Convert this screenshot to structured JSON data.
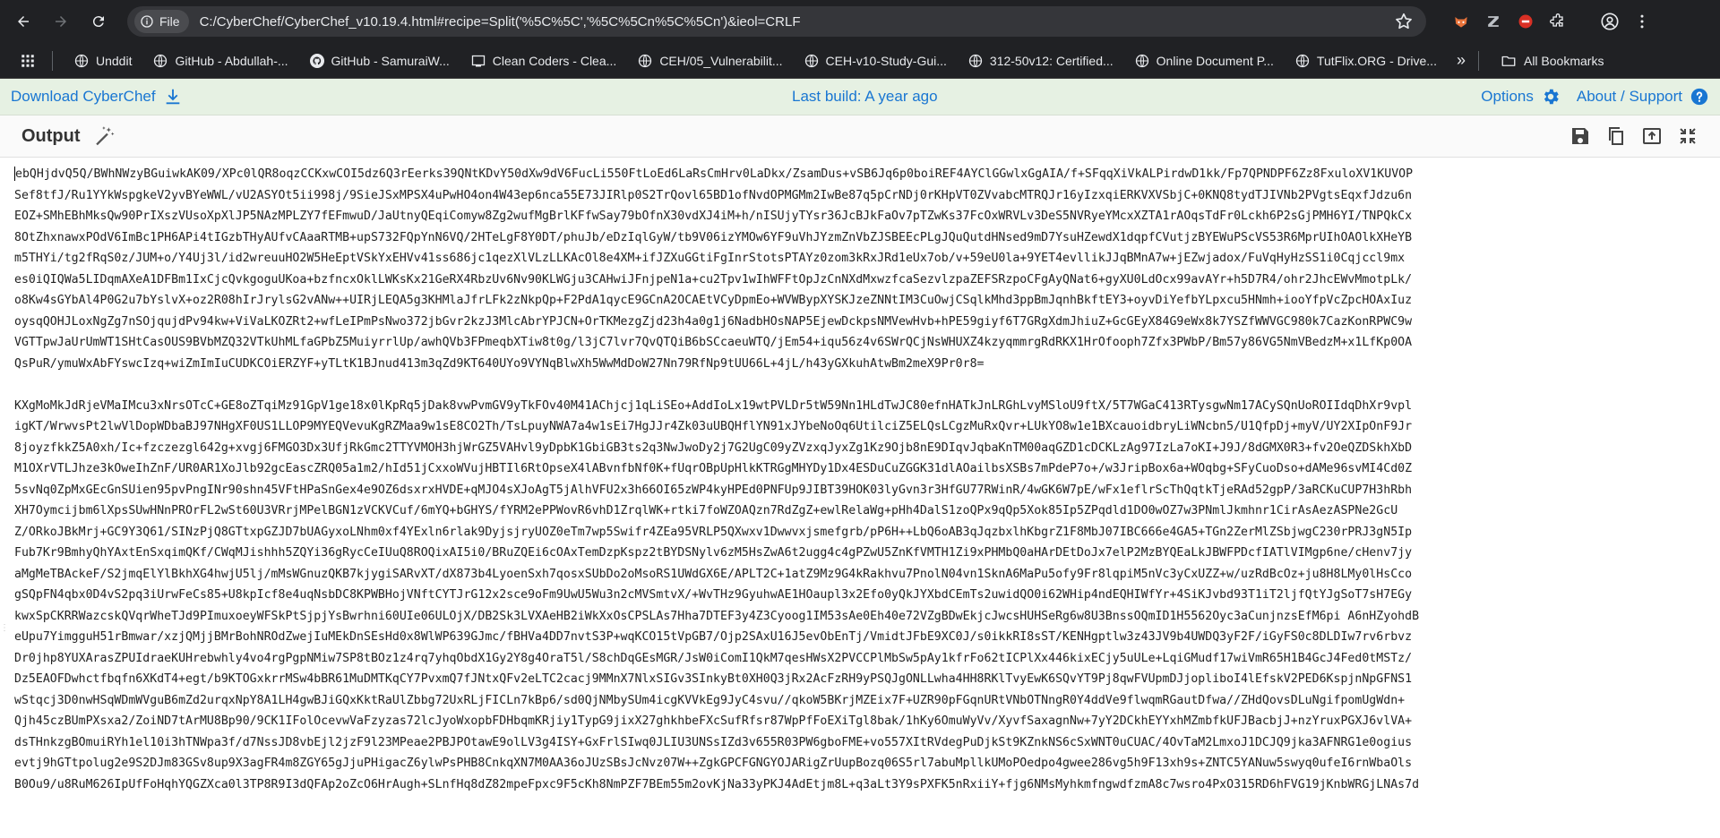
{
  "browser": {
    "url": "C:/CyberChef/CyberChef_v10.19.4.html#recipe=Split('%5C%5C','%5C%5Cn%5C%5Cn')&ieol=CRLF",
    "file_chip": "File",
    "bookmarks": [
      {
        "label": "Unddit",
        "icon": "globe-icon"
      },
      {
        "label": "GitHub - Abdullah-...",
        "icon": "globe-icon"
      },
      {
        "label": "GitHub - SamuraiW...",
        "icon": "github-icon"
      },
      {
        "label": "Clean Coders - Clea...",
        "icon": "cleancoders-icon"
      },
      {
        "label": "CEH/05_Vulnerabilit...",
        "icon": "globe-icon"
      },
      {
        "label": "CEH-v10-Study-Gui...",
        "icon": "globe-icon"
      },
      {
        "label": "312-50v12: Certified...",
        "icon": "globe-icon"
      },
      {
        "label": "Online Document P...",
        "icon": "globe-icon"
      },
      {
        "label": "TutFlix.ORG - Drive...",
        "icon": "globe-icon"
      }
    ],
    "bookmarks_more": "»",
    "all_bookmarks": "All Bookmarks"
  },
  "banner": {
    "download": "Download CyberChef",
    "last_build": "Last build: A year ago",
    "options": "Options",
    "about": "About / Support"
  },
  "output": {
    "title": "Output",
    "block1": [
      "ebQHjdvQ5Q/BWhNWzyBGuiwkAK09/XPc0lQR8oqzCCKxwCOI5dz6Q3rEerks39QNtKDvY50dXw9dV6FucLi550FtLoEd6LaRsCmHrv0LaDkx/ZsamDus+vSB6Jq6p0boiREF4AYClGGwlxGgAIA/f+SFqqXiVkALPirdwD1kk/Fp7QPNDPF6Zz8FxuloXV1KUVOP",
      "Sef8tfJ/Ru1YYkWspgkeV2yvBYeWWL/vU2ASYOt5ii998j/9SieJSxMPSX4uPwHO4on4W43ep6nca55E73JIRlp0S2TrQovl65BD1ofNvdOPMGMm2IwBe87q5pCrNDj0rKHpVT0ZVvabcMTRQJr16yIzxqiERKVXVSbjC+0KNQ8tydTJIVNb2PVgtsEqxfJdzu6n",
      "EOZ+SMhEBhMksQw90PrIXszVUsoXpXlJP5NAzMPLZY7fEFmwuD/JaUtnyQEqiComyw8Zg2wufMgBrlKFfwSay79bOfnX30vdXJ4iM+h/nISUjyTYsr36JcBJkFaOv7pTZwKs37FcOxWRVLv3DeS5NVRyeYMcxXZTA1rAOqsTdFr0Lckh6P2sGjPMH6YI/TNPQkCx",
      "8OtZhxnawxPOdV6ImBc1PH6APi4tIGzbTHyAUfvCAaaRTMB+upS732FQpYnN6VQ/2HTeLgF8Y0DT/phuJb/eDzIqlGyW/tb9V06izYMOw6YF9uVhJYzmZnVbZJSBEEcPLgJQuQutdHNsed9mD7YsuHZewdX1dqpfCVutjzBYEWuPScVS53R6MprUIhOAOlkXHeYB",
      "m5THYi/tg2fRqS0z/JUM+o/Y4Uj3l/id2wreuuHO2W5HeEptVSkYxEHVv41ss686jc1qezXlVLzLLKAcOl8e4XM+ifJZXuGGtiFgInrStotsPTAYz0zom3kRxJRd1eUx7ob/v+59eU0la+9YET4evllikJJqBMnA7w+jEZwjadox/FuVqHyHzSS1i0Cqjccl9mx",
      "es0iQIQWa5LIDqmAXeA1DFBm1IxCjcQvkgoguUKoa+bzfncxOklLWKsKx21GeRX4RbzUv6Nv90KLWGju3CAHwiJFnjpeN1a+cu2Tpv1wIhWFFtOpJzCnNXdMxwzfcaSezvlzpaZEFSRzpoCFgAyQNat6+gyXU0LdOcx99avAYr+h5D7R4/ohr2JhcEWvMmotpLk/",
      "o8Kw4sGYbAl4P0G2u7bYslvX+oz2R08hIrJrylsG2vANw++UIRjLEQA5g3KHMlaJfrLFk2zNkpQp+F2PdA1qycE9GCnA2OCAEtVCyDpmEo+WVWBypXYSKJzeZNNtIM3CuOwjCSqlkMhd3ppBmJqnhBkftEY3+oyvDiYefbYLpxcu5HNmh+iooYfpVcZpcHOAxIuz",
      "oysqQOHJLoxNgZg7nSOjqujdPv94kw+ViVaLKOZRt2+wfLeIPmPsNwo372jbGvr2kzJ3MlcAbrYPJCN+OrTKMezgZjd23h4a0g1j6NadbHOsNAP5EjewDckpsNMVewHvb+hPE59giyf6T7GRgXdmJhiuZ+GcGEyX84G9eWx8k7YSZfWWVGC980k7CazKonRPWC9w",
      "VGTTpwJaUrUmWT1SHtCasOUS9BVbMZQ32VTkUhMLfaGPbZ5MuiyrrlUp/awhQVb3FPmeqbXTiw8t0g/l3jC7lvr7QvQTQiB6bSCcaeuWTQ/jEm54+iqu56z4v6SWrQCjNsWHUXZ4kzyqmmrgRdRKX1HrOfooph7Zfx3PWbP/Bm57y86VG5NmVBedzM+x1LfKp0OA",
      "QsPuR/ymuWxAbFYswcIzq+wiZmImIuCUDKCOiERZYF+yTLtK1BJnud413m3qZd9KT640UYo9VYNqBlwXh5WwMdDoW27Nn79RfNp9tUU66L+4jL/h43yGXkuhAtwBm2meX9Pr0r8="
    ],
    "block2": [
      "KXgMoMkJdRjeVMaIMcu3xNrsOTcC+GE8oZTqiMz91GpV1ge18x0lKpRq5jDak8vwPvmGV9yTkFOv40M41AChjcj1qLiSEo+AddIoLx19wtPVLDr5tW59Nn1HLdTwJC80efnHATkJnLRGhLvyMSloU9ftX/5T7WGaC413RTysgwNm17ACySQnUoROIIdqDhXr9vpl",
      "igKT/WrwvsPt2lwVlDopWDbaBJ97NHgXF0US1LLOP9MYEQVevuKgRZMaa9w1sE8CO2Th/TsLpuyNWA7a4w1sEi7HgJJr4Zk03uUBQHflYN91xJYbeNoOq6UtilciZ5ELQsLCgzMuRxQvr+LUkYO8w1e1BXcauoidbryLiWNcbn5/U1QfpDj+myV/UY2XIpOnF9Jr",
      "8joyzfkkZ5A0xh/Ic+fzczezgl642g+xvgj6FMGO3Dx3UfjRkGmc2TTYVMOH3hjWrGZ5VAHvl9yDpbK1GbiGB3ts2q3NwJwoDy2j7G2UgC09yZVzxqJyxZg1Kz9Ojb8nE9DIqvJqbaKnTM00aqGZD1cDCKLzAg97IzLa7oKI+J9J/8dGMX0R3+fv2OeQZDSkhXbD",
      "M1OXrVTLJhze3kOweIhZnF/UR0AR1XoJlb92gcEascZRQ05a1m2/hId51jCxxoWVujHBTIl6RtOpseX4lABvnfbNf0K+fUqrOBpUpHlkKTRGgMHYDy1Dx4ESDuCuZGGK31dlAOailbsXSBs7mPdeP7o+/w3JripBox6a+WOqbg+SFyCuoDso+dAMe96svMI4Cd0Z",
      "5svNq0ZpMxGEcGnSUien95pvPngINr90shn45VFtHPaSnGex4e9OZ6dsxrxHVDE+qMJO4sXJoAgT5jAlhVFU2x3h66OI65zWP4kyHPEd0PNFUp9JIBT39HOK03lyGvn3r3HfGU77RWinR/4wGK6W7pE/wFx1eflrScThQqtkTjeRAd52gpP/3aRCKuCUP7H3hRbh",
      "XH7Oymcijbm6lXpsSUwHNnPROrFL2wSt60U3VRrjMPelBGN1zVCKVCuf/6mYQ+bGHYS/fYRM2ePPWovR6vhD1ZrqlWK+rtki7foWZOAQzn7RdZgZ+ewlRelaWg+pHh4DalS1zoQPx9qQp5Xok85Ip5ZPqdld1DO0wOZ7w3PNmlJkmhnr1CirAsAezASPNe2GcU",
      "Z/ORkoJBkMrj+GC9Y3Q61/SINzPjQ8GTtxpGZJD7bUAGyxoLNhm0xf4YExln6rlak9DyjsjryUOZ0eTm7wp5Swifr4ZEa95VRLP5QXwxv1Dwwvxjsmefgrb/pP6H++LbQ6oAB3qJqzbxlhKbgrZ1F8MbJ07IBC666e4GA5+TGn2ZerMlZSbjwgC230rPRJ3gN5Ip",
      "Fub7Kr9BmhyQhYAxtEnSxqimQKf/CWqMJishhh5ZQYi36gRycCeIUuQ8ROQixAI5i0/BRuZQEi6cOAxTemDzpKspz2tBYDSNylv6zM5HsZwA6t2ugg4c4gPZwU5ZnKfVMTH1Zi9xPHMbQ0aHArDEtDoJx7elP2MzBYQEaLkJBWFPDcfIATlVIMgp6ne/cHenv7jy",
      "aMgMeTBAckeF/S2jmqElYlBkhXG4hwjU5lj/mMsWGnuzQKB7kjygiSARvXT/dX873b4LyoenSxh7qosxSUbDo2oMsoRS1UWdGX6E/APLT2C+1atZ9Mz9G4kRakhvu7PnolN04vn1SknA6MaPu5ofy9Fr8lqpiM5nVc3yCxUZZ+w/uzRdBcOz+ju8H8LMy0lHsCco",
      "gSQpFN4qbx0D4vS2pq3iUrwFeCs85+U8kpIcf8e4uqNsbDC8KPWBHojVNftCYTJrG12x2sce9oFm9UwU5Wu3n2cMVSmtvX/+WvTHz9GyuhwAE1HOaupl3x2Efo0yQkJYXbdCEmTs2uwidQO0i62WHip4ndEQHIWfYr+4SiKJvbd93T1iT2ljfQtYJgSoT7sH7EGy",
      "kwxSpCKRRWazcskQVqrWheTJd9PImuxoeyWFSkPtSjpjYsBwrhni60UIe06ULOjX/DB2Sk3LVXAeHB2iWkXxOsCPSLAs7Hha7DTEF3y4Z3Cyoog1IM53sAe0Eh40e72VZgBDwEkjcJwcsHUHSeRg6w8U3BnssOQmID1H5562Oyc3aCunjnzsEfM6pi A6nHZyohdB",
      "eUpu7YimgguH51rBmwar/xzjQMjjBMrBohNROdZwejIuMEkDnSEsHd0x8WlWP639GJmc/fBHVa4DD7nvtS3P+wqKCO15tVpGB7/Ojp2SAxU16J5evObEnTj/VmidtJFbE9XC0J/s0ikkRI8sST/KENHgptlw3z43JV9b4UWDQ3yF2F/iGyFS0c8DLDIw7rv6rbvz",
      "Dr0jhp8YUXArasZPUIdraeKUHrebwhly4vo4rgPgpNMiw7SP8tBOz1z4rq7yhqObdX1Gy2Y8g4OraT5l/S8chDqGEsMGR/JsW0iComI1QkM7qesHWsX2PVCCPlMbSw5pAy1kfrFo62tICPlXx446kixECjy5uULe+LqiGMudf17wiVmR65H1B4GcJ4Fed0tMSTz/",
      "Dz5EAOFDwhctfbqfn6XKdT4+egt/b9KTOGxkrrMSw4bBR61MuDMTKqCY7PvxmQ7fJNtxQFv2eLTC2cacj9MMnX7NlxSIGv3SInkyBt0XH0Q3jRx2AcFzRH9yPSQJgONLLwha4HH8RKlTvyEwK6SQvYT9Pj8qwFVUpmDJjopliboI4lEfskV2PED6KspjnNpGFNS1",
      "wStqcj3D0nwHSqWDmWVguB6mZd2urqxNpY8A1LH4gwBJiGQxKktRaUlZbbg72UxRLjFICLn7kBp6/sd0QjNMbySUm4icgKVVkEg9JyC4svu//qkoW5BKrjMZEix7F+UZR90pFGqnURtVNbOTNngR0Y4ddVe9flwqmRGautDfwa//ZHdQovsDLuNgifpomUgWdn+",
      "Qjh45czBUmPXsxa2/ZoiND7tArMU8Bp90/9CK1IFolOcevwVaFzyzas72lcJyoWxopbFDHbqmKRjiy1TypG9jixX27ghkhbeFXcSufRfsr87WpPfFoEXiTgl8bak/1hKy6OmuWyVv/XyvfSaxagnNw+7yY2DCkhEYYxhMZmbfkUFJBacbjJ+nzYruxPGXJ6vlVA+",
      "dsTHnkzgBOmuiRYh1el10i3hTNWpa3f/d7NssJD8vbEjl2jzF9l23MPeae2PBJPOtawE9olLV3g4ISY+GxFrlSIwq0JLIU3UNSsIZd3v655R03PW6gboFME+vo557XItRVdegPuDjkSt9KZnkNS6cSxWNT0uCUAC/4OvTaM2LmxoJ1DCJQ9jka3AFNRG1e0ogius",
      "evtj9hGTtpolug2e9S2DJm83GSv8up9X3agFR4m8ZGY65gJjuPHigacZ6ylwPsPHB8CnkqXN7M0AA36oJUzSBsJcNvz07W++ZgkGPCFGNGYOJARigZrUupBozq06S5rl7abuMpllkUMoPOedpo4gwee286vg5h9F13xh9s+ZNTC5YANuw5swyq0ufeI6rnWbaOls",
      "B0Ou9/u8RuM626IpUfFoHqhYQGZXca0l3TP8R9I3dQFAp2oZcO6HrAugh+SLnfHq8dZ82mpeFpxc9F5cKh8NmPZF7BEm55m2ovKjNa33yPKJ4AdEtjm8L+q3aLt3Y9sPXFK5nRxiiY+fjg6NMsMyhkmfngwdfzmA8c7wsro4PxO315RD6hFVG19jKnbWRGjLNAs7d"
    ]
  }
}
